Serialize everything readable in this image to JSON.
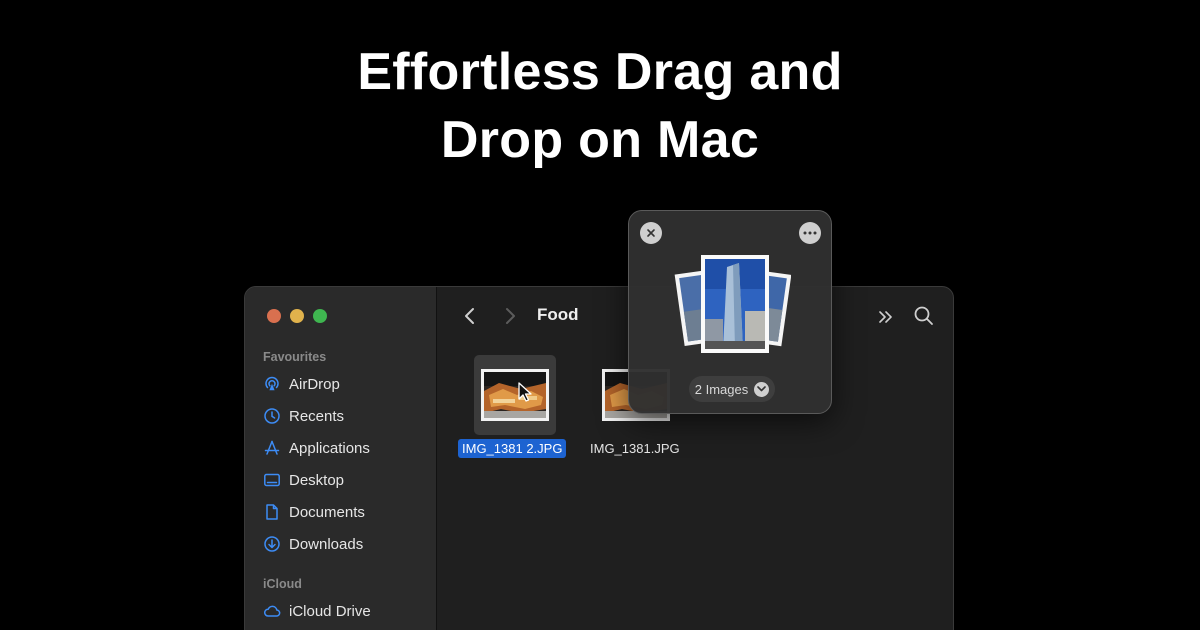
{
  "headline": {
    "line1": "Effortless Drag and",
    "line2": "Drop on Mac"
  },
  "finder": {
    "folder_title": "Food",
    "sidebar": {
      "favourites_title": "Favourites",
      "favourites": [
        {
          "label": "AirDrop",
          "icon": "airdrop-icon"
        },
        {
          "label": "Recents",
          "icon": "clock-icon"
        },
        {
          "label": "Applications",
          "icon": "applications-icon"
        },
        {
          "label": "Desktop",
          "icon": "desktop-icon"
        },
        {
          "label": "Documents",
          "icon": "document-icon"
        },
        {
          "label": "Downloads",
          "icon": "download-icon"
        }
      ],
      "icloud_title": "iCloud",
      "icloud": [
        {
          "label": "iCloud Drive",
          "icon": "cloud-icon"
        }
      ]
    },
    "files": [
      {
        "name": "IMG_1381 2.JPG",
        "selected": true
      },
      {
        "name": "IMG_1381.JPG",
        "selected": false
      }
    ]
  },
  "shelf": {
    "count_label": "2 Images"
  },
  "colors": {
    "background": "#000000",
    "accent_selection": "#1d63d1",
    "traffic_red": "#d9704f",
    "traffic_yellow": "#e0b24c",
    "traffic_green": "#3fb650",
    "sidebar_icon": "#3d8cf5"
  }
}
